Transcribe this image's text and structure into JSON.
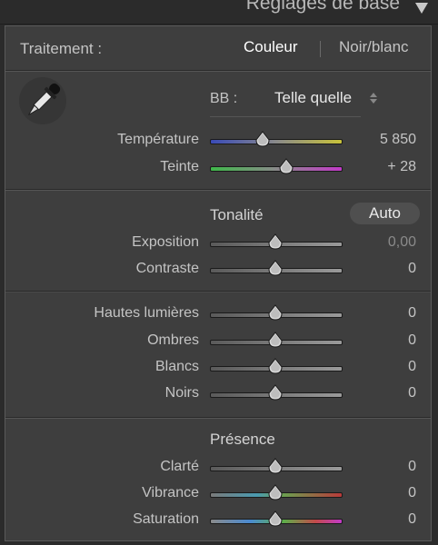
{
  "panel_title": "Réglages de base",
  "treatment": {
    "label": "Traitement :",
    "color_option": "Couleur",
    "bw_option": "Noir/blanc"
  },
  "white_balance": {
    "label": "BB :",
    "value": "Telle quelle"
  },
  "wb_sliders": [
    {
      "label": "Température",
      "value": "5 850",
      "position": 0.4
    },
    {
      "label": "Teinte",
      "value": "+ 28",
      "position": 0.58
    }
  ],
  "tone": {
    "title": "Tonalité",
    "auto_label": "Auto",
    "sliders": [
      {
        "label": "Exposition",
        "value": "0,00",
        "position": 0.5
      },
      {
        "label": "Contraste",
        "value": "0",
        "position": 0.5
      }
    ]
  },
  "tone_detail_sliders": [
    {
      "label": "Hautes lumières",
      "value": "0",
      "position": 0.5
    },
    {
      "label": "Ombres",
      "value": "0",
      "position": 0.5
    },
    {
      "label": "Blancs",
      "value": "0",
      "position": 0.5
    },
    {
      "label": "Noirs",
      "value": "0",
      "position": 0.5
    }
  ],
  "presence": {
    "title": "Présence",
    "sliders": [
      {
        "label": "Clarté",
        "value": "0",
        "position": 0.5
      },
      {
        "label": "Vibrance",
        "value": "0",
        "position": 0.5
      },
      {
        "label": "Saturation",
        "value": "0",
        "position": 0.5
      }
    ]
  },
  "colors": {
    "panel_bg": "#3e3e3e",
    "text": "#c4c4c4",
    "highlight_text": "#ffffff"
  }
}
